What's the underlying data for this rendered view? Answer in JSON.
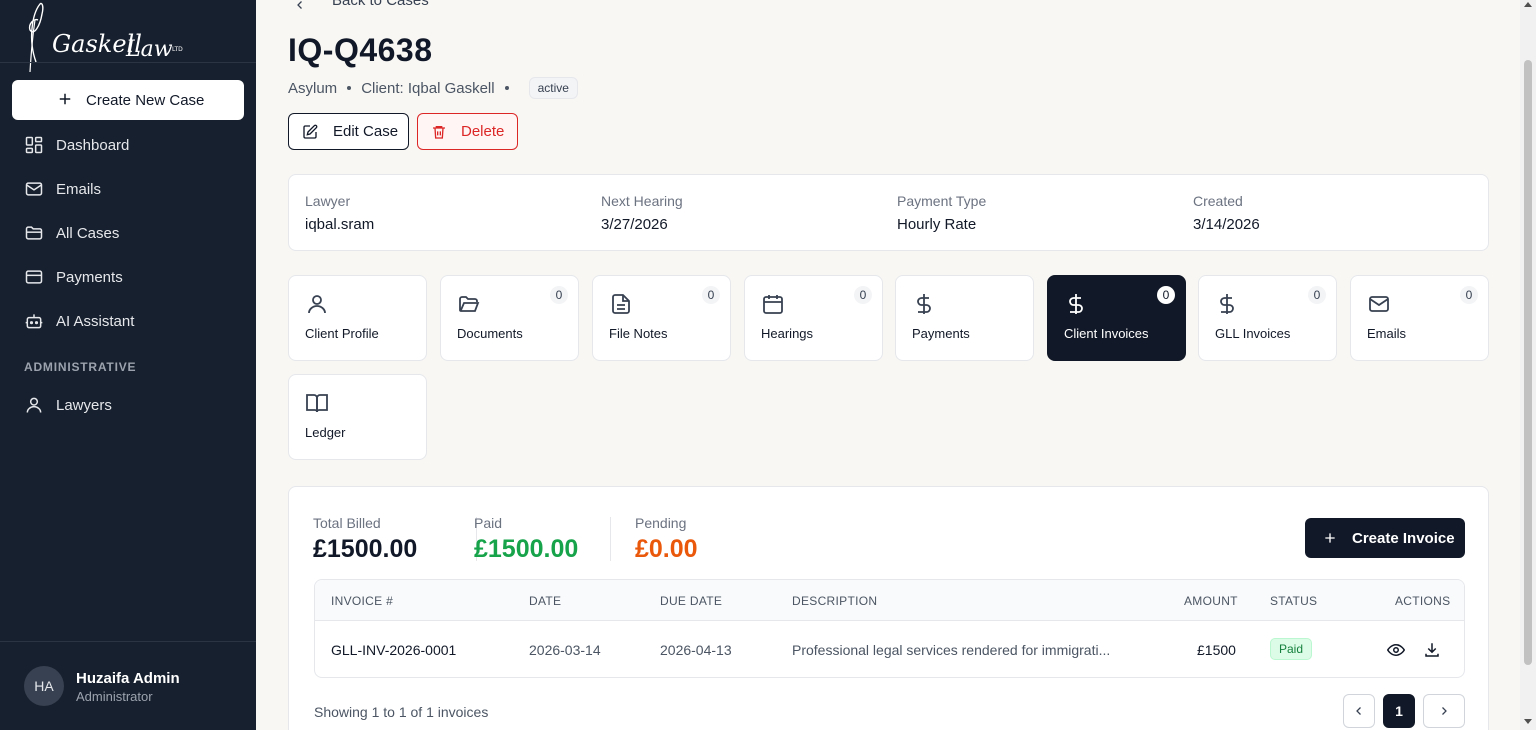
{
  "brand": {
    "name": "Gaskell Law",
    "suffix": "LTD"
  },
  "sidebar": {
    "create_label": "Create New Case",
    "items": [
      {
        "label": "Dashboard",
        "icon": "dashboard-icon"
      },
      {
        "label": "Emails",
        "icon": "mail-icon"
      },
      {
        "label": "All Cases",
        "icon": "folder-icon"
      },
      {
        "label": "Payments",
        "icon": "credit-card-icon"
      },
      {
        "label": "AI Assistant",
        "icon": "bot-icon"
      }
    ],
    "section_title": "ADMINISTRATIVE",
    "admin_items": [
      {
        "label": "Lawyers",
        "icon": "user-icon"
      }
    ],
    "user": {
      "initials": "HA",
      "name": "Huzaifa Admin",
      "role": "Administrator"
    }
  },
  "header": {
    "back_label": "Back to Cases",
    "case_id": "IQ-Q4638",
    "case_type": "Asylum",
    "client": "Client: Iqbal Gaskell",
    "status": "active",
    "edit_label": "Edit Case",
    "delete_label": "Delete"
  },
  "info": [
    {
      "label": "Lawyer",
      "value": "iqbal.sram"
    },
    {
      "label": "Next Hearing",
      "value": "3/27/2026"
    },
    {
      "label": "Payment Type",
      "value": "Hourly Rate"
    },
    {
      "label": "Created",
      "value": "3/14/2026"
    }
  ],
  "tabs": [
    {
      "label": "Client Profile",
      "icon": "user-icon",
      "count": null
    },
    {
      "label": "Documents",
      "icon": "folder-open-icon",
      "count": "0"
    },
    {
      "label": "File Notes",
      "icon": "file-text-icon",
      "count": "0"
    },
    {
      "label": "Hearings",
      "icon": "calendar-icon",
      "count": "0"
    },
    {
      "label": "Payments",
      "icon": "dollar-icon",
      "count": null
    },
    {
      "label": "Client Invoices",
      "icon": "dollar-icon",
      "count": "0",
      "active": true
    },
    {
      "label": "GLL Invoices",
      "icon": "dollar-icon",
      "count": "0"
    },
    {
      "label": "Emails",
      "icon": "mail-icon",
      "count": "0"
    },
    {
      "label": "Ledger",
      "icon": "book-open-icon",
      "count": null
    }
  ],
  "invoices": {
    "totals": {
      "billed_label": "Total Billed",
      "billed": "£1500.00",
      "paid_label": "Paid",
      "paid": "£1500.00",
      "pending_label": "Pending",
      "pending": "£0.00"
    },
    "create_label": "Create Invoice",
    "columns": [
      "INVOICE #",
      "DATE",
      "DUE DATE",
      "DESCRIPTION",
      "AMOUNT",
      "STATUS",
      "ACTIONS"
    ],
    "rows": [
      {
        "invoice": "GLL-INV-2026-0001",
        "date": "2026-03-14",
        "due": "2026-04-13",
        "description": "Professional legal services rendered for immigrati...",
        "amount": "£1500",
        "status": "Paid"
      }
    ],
    "showing": "Showing 1 to 1 of 1 invoices",
    "page": "1"
  },
  "colors": {
    "sidebar_bg": "#17202e",
    "accent_dark": "#111827",
    "paid_green": "#16a34a",
    "pending_orange": "#ea580c",
    "danger_red": "#dc2626"
  }
}
